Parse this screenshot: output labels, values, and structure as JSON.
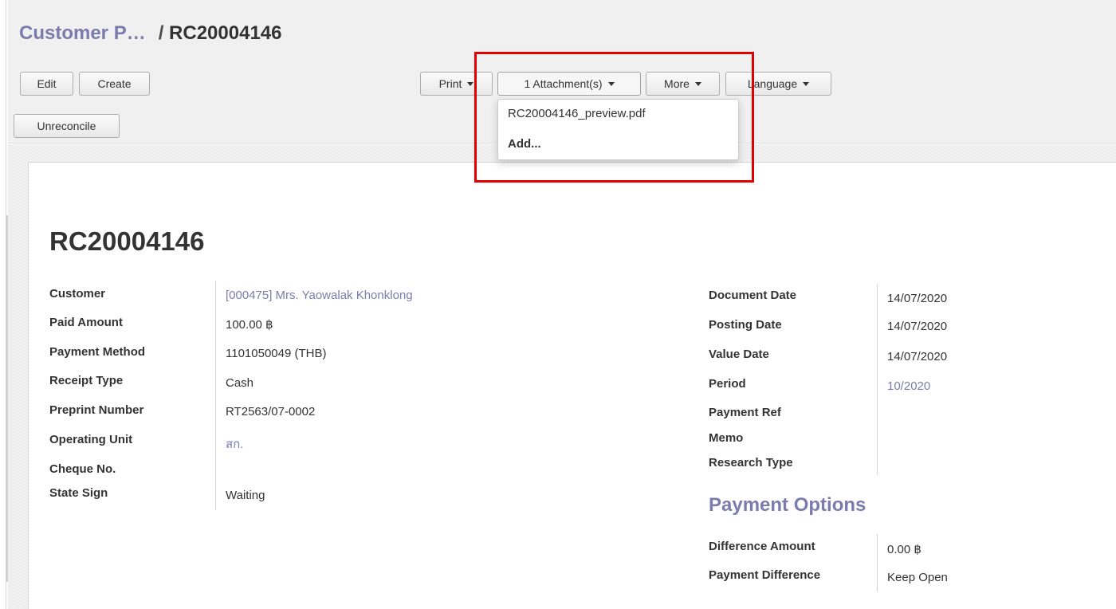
{
  "breadcrumb": {
    "parent": "Customer P…",
    "separator": "/",
    "current": "RC20004146"
  },
  "toolbar": {
    "edit_label": "Edit",
    "create_label": "Create",
    "unreconcile_label": "Unreconcile",
    "print_label": "Print",
    "attachments_label": "1 Attachment(s)",
    "more_label": "More",
    "language_label": "Language"
  },
  "attachments_menu": {
    "items": [
      {
        "label": "RC20004146_preview.pdf"
      }
    ],
    "add_label": "Add..."
  },
  "document": {
    "title": "RC20004146",
    "left_fields": [
      {
        "label": "Customer",
        "value": "[000475] Mrs. Yaowalak Khonklong"
      },
      {
        "label": "Paid Amount",
        "value": "100.00 ฿"
      },
      {
        "label": "Payment Method",
        "value": "1101050049 (THB)"
      },
      {
        "label": "Receipt Type",
        "value": "Cash"
      },
      {
        "label": "Preprint Number",
        "value": "RT2563/07-0002"
      },
      {
        "label": "Operating Unit",
        "value": "สก."
      },
      {
        "label": "Cheque No.",
        "value": ""
      },
      {
        "label": "State Sign",
        "value": "Waiting"
      }
    ],
    "right_fields": [
      {
        "label": "Document Date",
        "value": "14/07/2020"
      },
      {
        "label": "Posting Date",
        "value": "14/07/2020"
      },
      {
        "label": "Value Date",
        "value": "14/07/2020"
      },
      {
        "label": "Period",
        "value": "10/2020"
      },
      {
        "label": "Payment Ref",
        "value": ""
      },
      {
        "label": "Memo",
        "value": ""
      },
      {
        "label": "Research Type",
        "value": ""
      }
    ],
    "payment_options": {
      "title": "Payment Options",
      "fields": [
        {
          "label": "Difference Amount",
          "value": "0.00 ฿"
        },
        {
          "label": "Payment Difference",
          "value": "Keep Open"
        }
      ]
    }
  },
  "colors": {
    "link": "#7c7bad",
    "highlight": "#e00000"
  }
}
